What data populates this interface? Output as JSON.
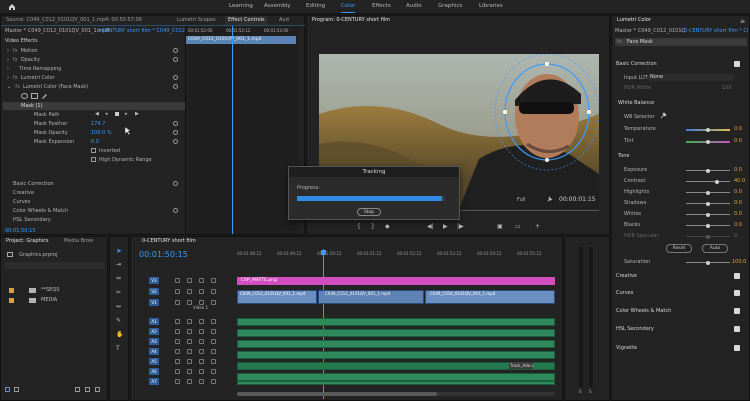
{
  "workspaces": [
    "Learning",
    "Assembly",
    "Editing",
    "Color",
    "Effects",
    "Audio",
    "Graphics",
    "Libraries"
  ],
  "active_workspace": "Color",
  "source_panel": {
    "tabs": [
      "Source: C049_C012_0101QV_001_1.mp4: 00:50:57:06",
      "Lumetri Scopes",
      "Effect Controls",
      "Aud"
    ],
    "header_left": "Master * C049_C012_0101QV_001_1.mp4",
    "header_right": "0-CENTURY short film * C049_C012...",
    "section": "Video Effects",
    "effects": [
      {
        "name": "Motion"
      },
      {
        "name": "Opacity"
      },
      {
        "name": "Time Remapping"
      },
      {
        "name": "Lumetri Color"
      },
      {
        "name": "Lumetri Color (Face Mask)"
      }
    ],
    "mask_name": "Mask (1)",
    "mask_props": [
      {
        "label": "Mask Path",
        "value": ""
      },
      {
        "label": "Mask Feather",
        "value": "174.7"
      },
      {
        "label": "Mask Opacity",
        "value": "100.0 %"
      },
      {
        "label": "Mask Expansion",
        "value": "0.0"
      }
    ],
    "inverted_label": "Inverted",
    "hdr_label": "High Dynamic Range",
    "sections": [
      "Basic Correction",
      "Creative",
      "Curves",
      "Color Wheels & Match",
      "HSL Secondary"
    ],
    "timecode": "00:01:50:15",
    "mini_timeline": {
      "ticks": [
        "00:01:52:00",
        "00:01:52:12",
        "00:01:53:00"
      ],
      "clip": "C049_C012_0101QV_001_1.mp4"
    }
  },
  "program_monitor": {
    "title": "Program: 0-CENTURY short film",
    "timecode_in": "",
    "fit": "Full",
    "timecode": "00:00:01:15"
  },
  "tracking_dialog": {
    "title": "Tracking",
    "progress_label": "Progress:",
    "progress": 0.98,
    "button": "Stop"
  },
  "lumetri": {
    "title": "Lumetri Color",
    "master_left": "Master * C049_C012_0101QV...",
    "master_right": "0-CENTURY short film * C049...",
    "fx_label": "Face Mask",
    "basic_correction": "Basic Correction",
    "input_lut_label": "Input LUT",
    "input_lut_value": "None",
    "hdr_white_label": "HDR White",
    "hdr_white_value": "100",
    "white_balance": "White Balance",
    "wb_selector": "WB Selector",
    "temperature": {
      "label": "Temperature",
      "value": "0.0"
    },
    "tint": {
      "label": "Tint",
      "value": "0.0"
    },
    "tone": "Tone",
    "tone_rows": [
      {
        "label": "Exposure",
        "value": "0.0",
        "pos": 0.5
      },
      {
        "label": "Contrast",
        "value": "40.0",
        "pos": 0.7
      },
      {
        "label": "Highlights",
        "value": "0.0",
        "pos": 0.5
      },
      {
        "label": "Shadows",
        "value": "0.0",
        "pos": 0.5
      },
      {
        "label": "Whites",
        "value": "0.0",
        "pos": 0.5
      },
      {
        "label": "Blacks",
        "value": "0.0",
        "pos": 0.5
      },
      {
        "label": "HDR Specular",
        "value": "0",
        "pos": 0.5
      }
    ],
    "reset_button": "Reset",
    "auto_button": "Auto",
    "saturation": {
      "label": "Saturation",
      "value": "100.0",
      "pos": 0.5
    },
    "sections": [
      "Creative",
      "Curves",
      "Color Wheels & Match",
      "HSL Secondary",
      "Vignette"
    ]
  },
  "project_panel": {
    "tabs": [
      "Project: Graphics",
      "Media Brow"
    ],
    "project_file": "Graphics.prproj",
    "items": [
      {
        "name": "**SEQS"
      },
      {
        "name": "MEDIA"
      }
    ]
  },
  "timeline": {
    "title": "0-CENTURY short film",
    "timecode": "00:01:50:15",
    "ticks": [
      "00:01:48:12",
      "00:01:49:12",
      "00:01:50:12",
      "00:01:51:12",
      "00:01:52:12",
      "00:01:53:12",
      "00:01:54:12",
      "00:01:55:12"
    ],
    "video_tracks": [
      "V3",
      "V2",
      "V1"
    ],
    "audio_tracks": [
      "A1",
      "A2",
      "A3",
      "A4",
      "A5",
      "A6",
      "A7"
    ],
    "v1_label": "Video 1",
    "adjustment_clip": "CSP_MATTE.png",
    "v1_clips": [
      "C049_C012_0101QV_001_1.mp4",
      "C049_C012_0101QV_001_1.mp4",
      "C049_C034_0101QV_001_1.mp4"
    ],
    "audio_clip_small": "Track_Ada.wav"
  },
  "colors": {
    "accent": "#3b9bff",
    "video_clip": "#6b8fc0",
    "audio_clip": "#2e8a5c",
    "adjustment": "#d24ec0"
  }
}
